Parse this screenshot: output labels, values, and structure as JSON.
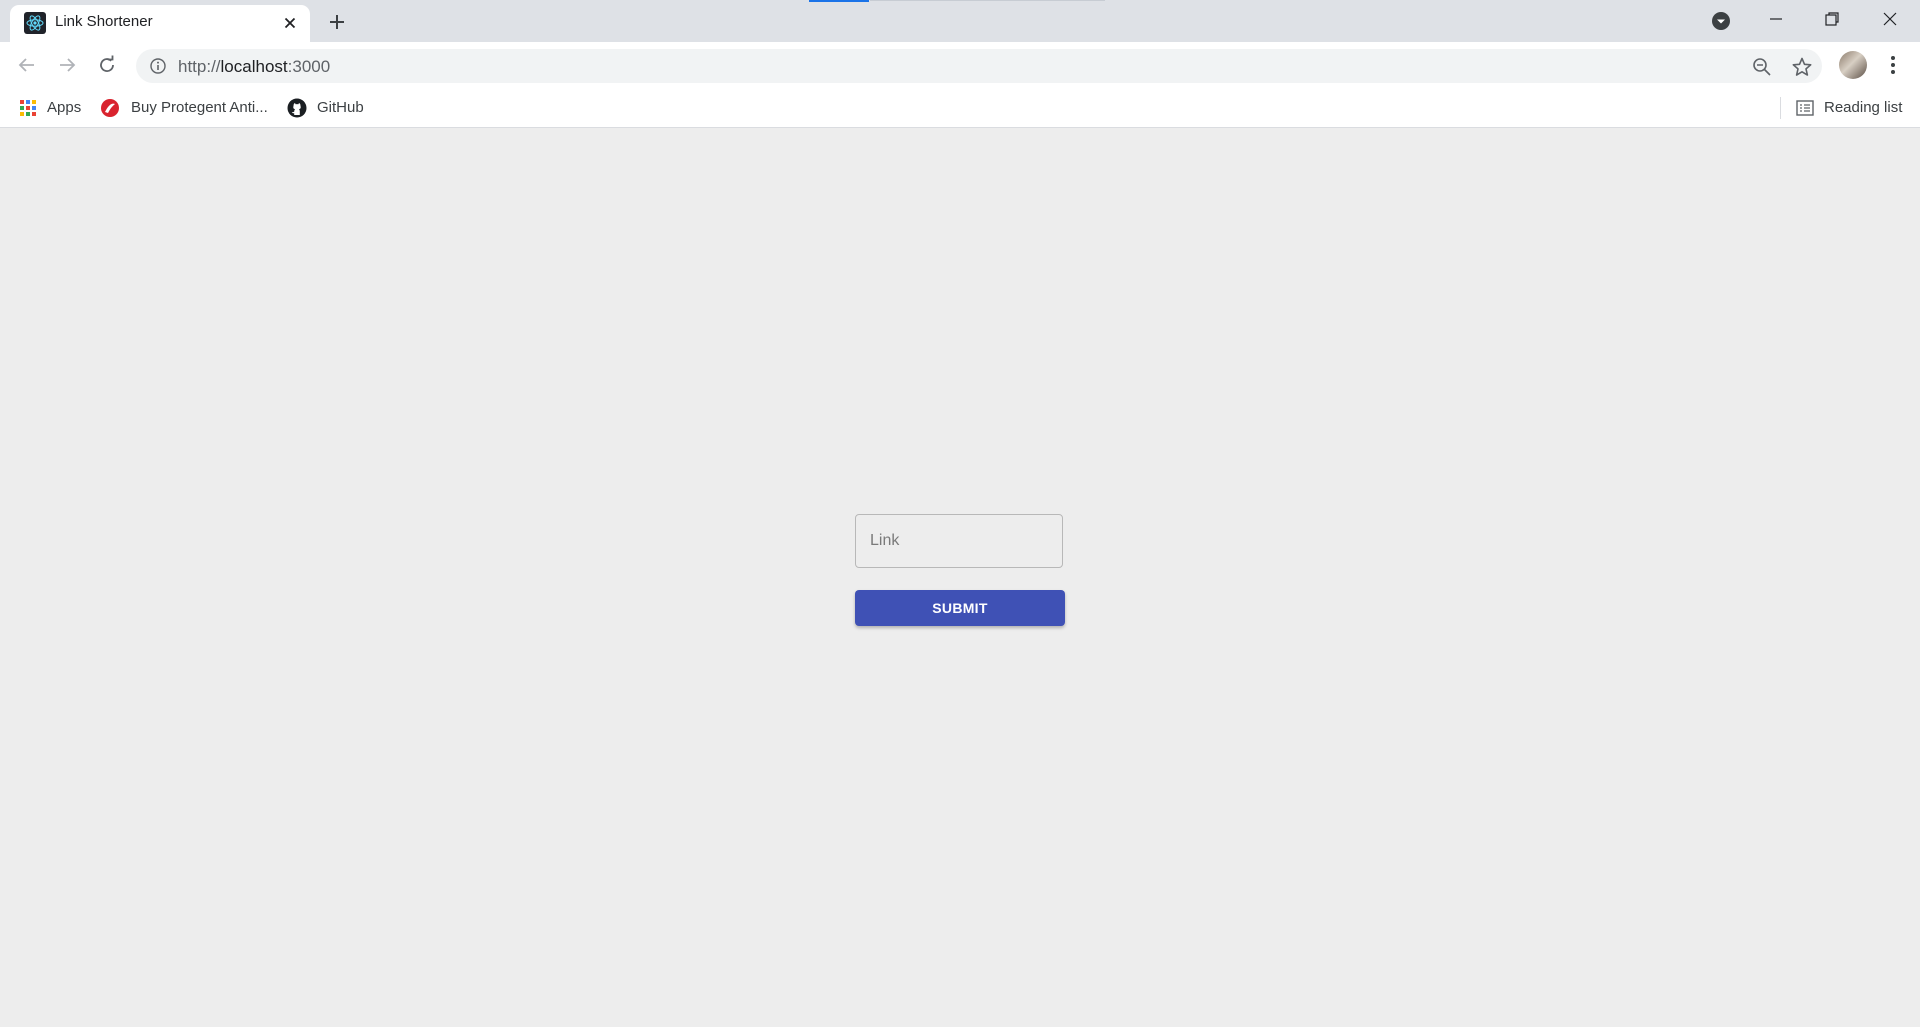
{
  "browser": {
    "tab": {
      "title": "Link Shortener",
      "favicon": "react-icon"
    },
    "address_bar": {
      "scheme": "http://",
      "host": "localhost",
      "port": ":3000"
    },
    "bookmarks": [
      {
        "label": "Apps",
        "icon": "apps-grid-icon"
      },
      {
        "label": "Buy Protegent Anti...",
        "icon": "protegent-icon"
      },
      {
        "label": "GitHub",
        "icon": "github-icon"
      }
    ],
    "reading_list": "Reading list",
    "accent_color": "#1a73e8"
  },
  "form": {
    "link_placeholder": "Link",
    "link_value": "",
    "submit_label": "SUBMIT",
    "button_color": "#3f51b5",
    "background_color": "#ededed"
  }
}
